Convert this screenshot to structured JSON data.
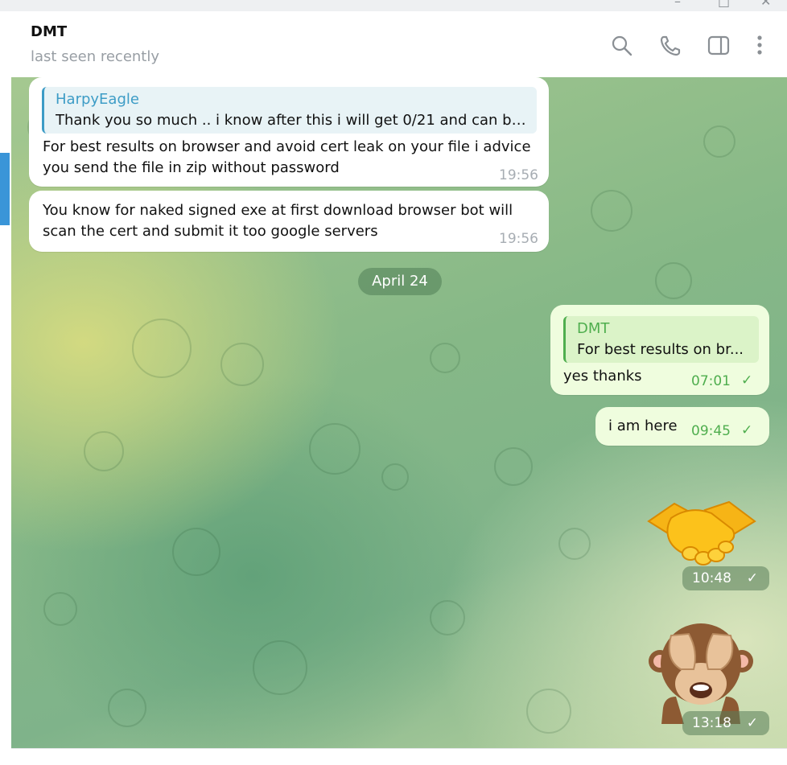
{
  "window": {
    "min_glyph": "–",
    "max_glyph": "□",
    "close_glyph": "✕"
  },
  "header": {
    "title": "DMT",
    "status": "last seen recently",
    "icons": [
      "search-icon",
      "phone-icon",
      "sidebar-panel-icon",
      "more-vertical-icon"
    ]
  },
  "messages": [
    {
      "direction": "incoming",
      "reply": {
        "name": "HarpyEagle",
        "text": "Thank you so much .. i know after this i will get 0/21 and can be ..."
      },
      "lines": [
        "For best results on browser and avoid cert leak on your file i advice",
        "you send the file in zip without password"
      ],
      "time": "19:56"
    },
    {
      "direction": "incoming",
      "lines": [
        "You know for naked signed exe at first download browser bot will",
        "scan the cert and submit it too google servers"
      ],
      "time": "19:56"
    },
    {
      "direction": "outgoing",
      "reply": {
        "name": "DMT",
        "text": "For best results on br..."
      },
      "text": "yes thanks",
      "time": "07:01"
    },
    {
      "direction": "outgoing",
      "text": "i am here",
      "time": "09:45"
    },
    {
      "direction": "outgoing",
      "sticker": "handshake",
      "time": "10:48"
    },
    {
      "direction": "outgoing",
      "sticker": "see-no-evil-monkey",
      "time": "13:18"
    }
  ],
  "date_separator": "April 24",
  "check_glyph": "✓",
  "colors": {
    "accent": "#3a95d8",
    "reply_name_in": "#3d9cc6",
    "reply_name_out": "#4fae4e",
    "outgoing_bubble": "#effdde",
    "time_out": "#4fae4e"
  }
}
